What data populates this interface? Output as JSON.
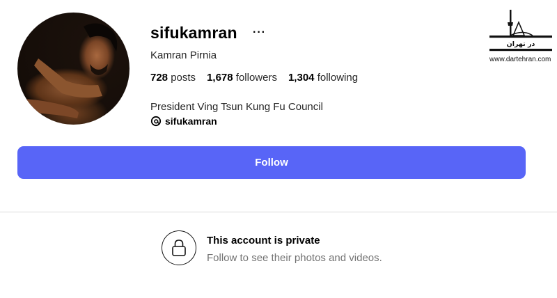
{
  "profile": {
    "username": "sifukamran",
    "more_label": "···",
    "full_name": "Kamran Pirnia",
    "posts_count": "728",
    "posts_label": "posts",
    "followers_count": "1,678",
    "followers_label": "followers",
    "following_count": "1,304",
    "following_label": "following",
    "bio": "President Ving Tsun Kung Fu Council",
    "threads_handle": "sifukamran",
    "threads_icon": "threads-icon"
  },
  "actions": {
    "follow_label": "Follow",
    "follow_color": "#5865f7"
  },
  "private_notice": {
    "title": "This account is private",
    "subtitle": "Follow to see their photos and videos.",
    "icon": "lock-icon"
  },
  "watermark": {
    "logo_text": "در تهران",
    "url": "www.dartehran.com"
  }
}
